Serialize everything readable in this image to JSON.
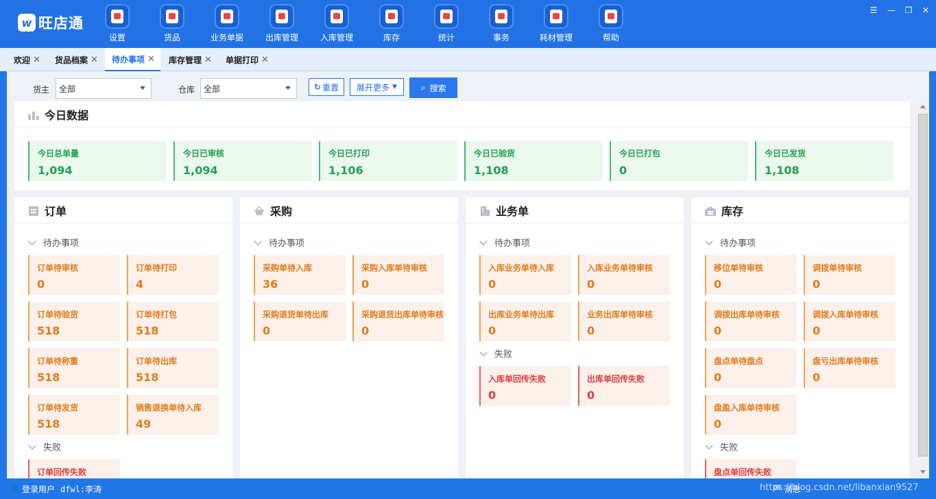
{
  "app": {
    "name": "旺店通",
    "logo_mark": "w"
  },
  "nav": [
    {
      "label": "设置",
      "icon": "settings-icon"
    },
    {
      "label": "货品",
      "icon": "goods-icon"
    },
    {
      "label": "业务单据",
      "icon": "business-docs-icon"
    },
    {
      "label": "出库管理",
      "icon": "outbound-icon"
    },
    {
      "label": "入库管理",
      "icon": "inbound-icon"
    },
    {
      "label": "库存",
      "icon": "inventory-icon"
    },
    {
      "label": "统计",
      "icon": "statistics-icon"
    },
    {
      "label": "事务",
      "icon": "affairs-icon"
    },
    {
      "label": "耗材管理",
      "icon": "consumables-icon"
    },
    {
      "label": "帮助",
      "icon": "help-icon"
    }
  ],
  "tabs": [
    {
      "label": "欢迎"
    },
    {
      "label": "货品档案"
    },
    {
      "label": "待办事项",
      "active": true
    },
    {
      "label": "库存管理"
    },
    {
      "label": "单据打印"
    }
  ],
  "filters": {
    "owner_label": "货主",
    "owner_value": "全部",
    "warehouse_label": "仓库",
    "warehouse_value": "全部",
    "reset_label": "重置",
    "expand_label": "展开更多",
    "search_label": "搜索"
  },
  "today": {
    "title": "今日数据",
    "stats": [
      {
        "label": "今日总单量",
        "value": "1,094"
      },
      {
        "label": "今日已审核",
        "value": "1,094"
      },
      {
        "label": "今日已打印",
        "value": "1,106"
      },
      {
        "label": "今日已验货",
        "value": "1,108"
      },
      {
        "label": "今日已打包",
        "value": "0"
      },
      {
        "label": "今日已发货",
        "value": "1,108"
      }
    ]
  },
  "panels": {
    "orders": {
      "title": "订单",
      "pending_label": "待办事项",
      "pending": [
        {
          "label": "订单待审核",
          "value": "0"
        },
        {
          "label": "订单待打印",
          "value": "4"
        },
        {
          "label": "订单待验货",
          "value": "518"
        },
        {
          "label": "订单待打包",
          "value": "518"
        },
        {
          "label": "订单待称重",
          "value": "518"
        },
        {
          "label": "订单待出库",
          "value": "518"
        },
        {
          "label": "订单待发货",
          "value": "518"
        },
        {
          "label": "销售退换单待入库",
          "value": "49"
        }
      ],
      "failed_label": "失败",
      "failed": [
        {
          "label": "订单回传失败"
        }
      ]
    },
    "purchase": {
      "title": "采购",
      "pending_label": "待办事项",
      "pending": [
        {
          "label": "采购单待入库",
          "value": "36"
        },
        {
          "label": "采购入库单待审核",
          "value": "0"
        },
        {
          "label": "采购退货单待出库",
          "value": "0"
        },
        {
          "label": "采购退货出库单待审核",
          "value": "0"
        }
      ]
    },
    "business": {
      "title": "业务单",
      "pending_label": "待办事项",
      "pending": [
        {
          "label": "入库业务单待入库",
          "value": "0"
        },
        {
          "label": "入库业务单待审核",
          "value": "0"
        },
        {
          "label": "出库业务单待出库",
          "value": "0"
        },
        {
          "label": "业务出库单待审核",
          "value": "0"
        }
      ],
      "failed_label": "失败",
      "failed": [
        {
          "label": "入库单回传失败",
          "value": "0"
        },
        {
          "label": "出库单回传失败",
          "value": "0"
        }
      ]
    },
    "stock": {
      "title": "库存",
      "pending_label": "待办事项",
      "pending": [
        {
          "label": "移位单待审核",
          "value": "0"
        },
        {
          "label": "调拨单待审核",
          "value": "0"
        },
        {
          "label": "调拨出库单待审核",
          "value": "0"
        },
        {
          "label": "调拨入库单待审核",
          "value": "0"
        },
        {
          "label": "盘点单待盘点",
          "value": "0"
        },
        {
          "label": "盘亏出库单待审核",
          "value": "0"
        },
        {
          "label": "盘盈入库单待审核",
          "value": "0"
        }
      ],
      "failed_label": "失败",
      "failed": [
        {
          "label": "盘点单回传失败"
        }
      ]
    }
  },
  "status": {
    "user_label": "登录用户",
    "user_value": "dfwl:李涛",
    "message_label": "消息",
    "watermark": "https://blog.csdn.net/libanxian9527"
  }
}
